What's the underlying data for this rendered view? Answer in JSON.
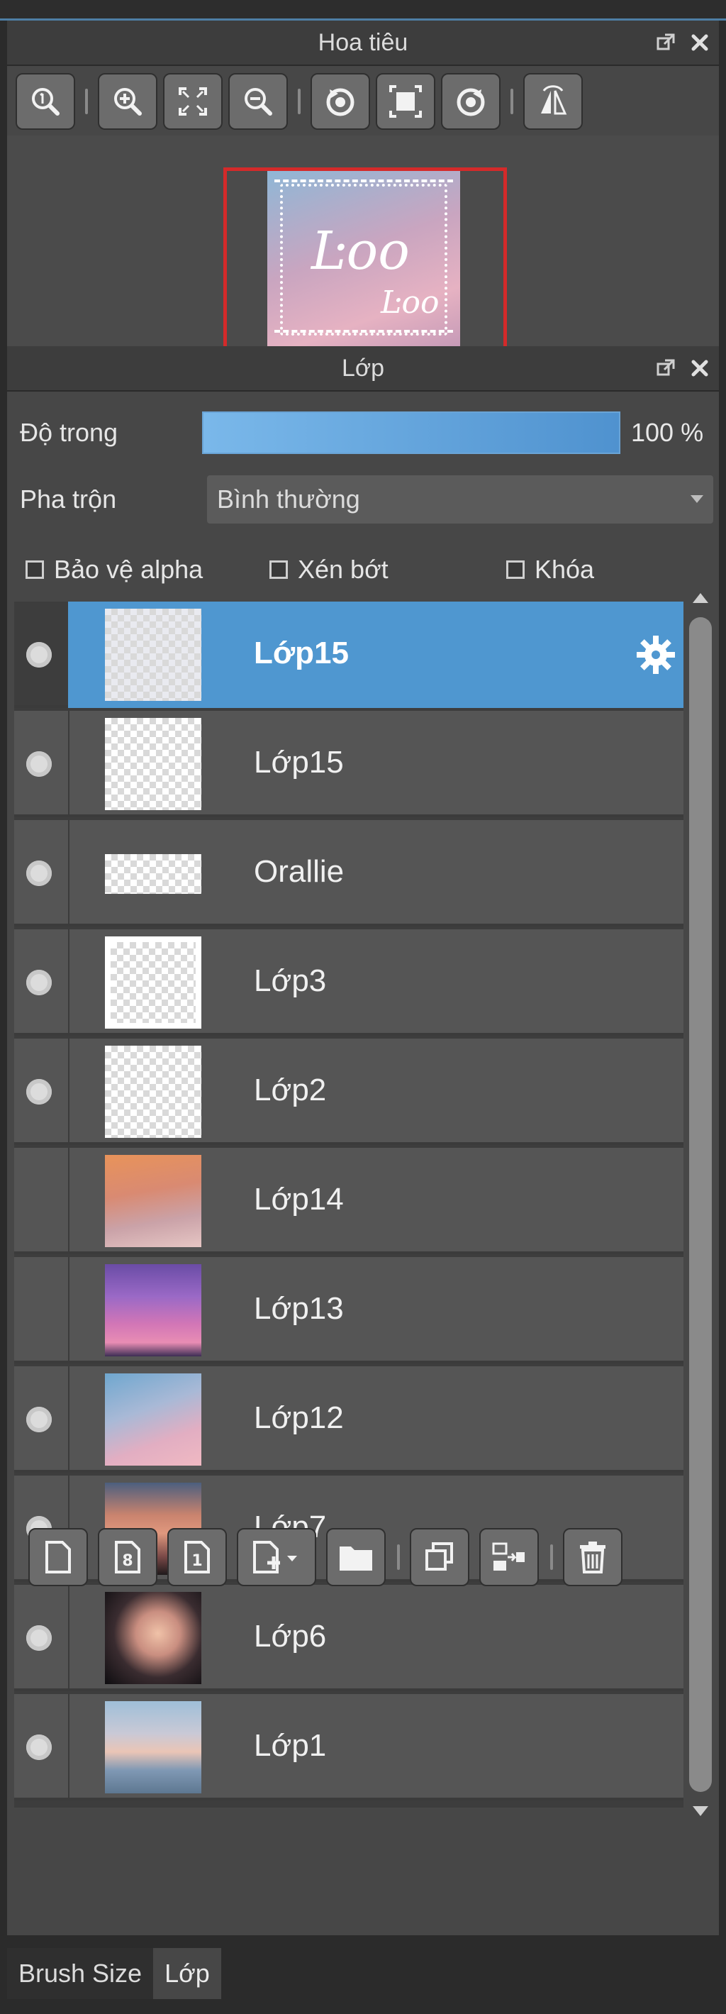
{
  "navigator": {
    "title": "Hoa tiêu",
    "thumbnail_text_large": "Ŀoo",
    "thumbnail_text_small": "Ŀoo",
    "toolbar_icons": [
      "zoom-actual-icon",
      "zoom-in-icon",
      "fit-screen-icon",
      "zoom-out-icon",
      "rotate-left-icon",
      "fullscreen-icon",
      "rotate-right-icon",
      "flip-icon"
    ]
  },
  "layers_panel": {
    "title": "Lớp",
    "opacity_label": "Độ trong",
    "opacity_value": "100 %",
    "opacity_fraction": 1.0,
    "blend_label": "Pha trộn",
    "blend_value": "Bình thường",
    "protect_alpha_label": "Bảo vệ alpha",
    "clipping_label": "Xén bớt",
    "lock_label": "Khóa",
    "layers": [
      {
        "name": "Lớp15",
        "visible": true,
        "selected": true
      },
      {
        "name": "Lớp15",
        "visible": true,
        "selected": false
      },
      {
        "name": "Orallie",
        "visible": true,
        "selected": false
      },
      {
        "name": "Lớp3",
        "visible": true,
        "selected": false
      },
      {
        "name": "Lớp2",
        "visible": true,
        "selected": false
      },
      {
        "name": "Lớp14",
        "visible": false,
        "selected": false
      },
      {
        "name": "Lớp13",
        "visible": false,
        "selected": false
      },
      {
        "name": "Lớp12",
        "visible": true,
        "selected": false
      },
      {
        "name": "Lớp7",
        "visible": true,
        "selected": false
      },
      {
        "name": "Lớp6",
        "visible": true,
        "selected": false
      },
      {
        "name": "Lớp1",
        "visible": true,
        "selected": false
      }
    ]
  },
  "bottom_tabs": {
    "brush_size": "Brush Size",
    "layer": "Lớp"
  },
  "colors": {
    "selected_row": "#4f97d0",
    "panel_bg": "#474747",
    "header_bg": "#3d3d3d",
    "nav_frame": "#d42a2a"
  }
}
